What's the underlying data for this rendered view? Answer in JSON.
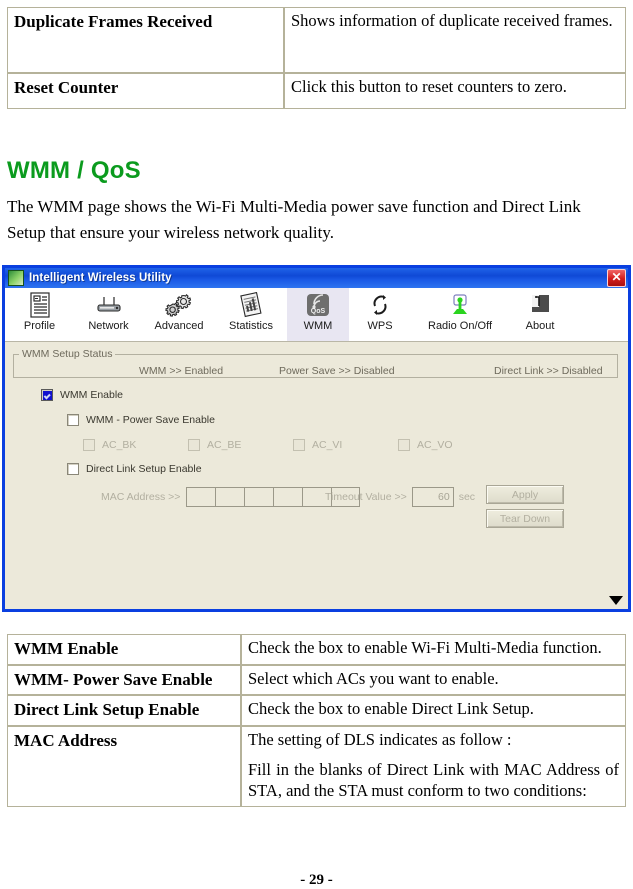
{
  "top_table": {
    "rows": [
      {
        "key": "Duplicate Frames Received",
        "value": "Shows information of duplicate received frames."
      },
      {
        "key": "Reset Counter",
        "value": "Click this button to reset counters to zero."
      }
    ]
  },
  "section": {
    "heading": "WMM / QoS",
    "intro": "The WMM page shows the Wi-Fi Multi-Media power save function and Direct Link Setup that ensure your wireless network quality."
  },
  "app": {
    "title": "Intelligent Wireless Utility",
    "close_label": "✕",
    "toolbar": [
      {
        "label": "Profile",
        "icon": "profile-icon",
        "selected": false
      },
      {
        "label": "Network",
        "icon": "network-icon",
        "selected": false
      },
      {
        "label": "Advanced",
        "icon": "advanced-icon",
        "selected": false
      },
      {
        "label": "Statistics",
        "icon": "statistics-icon",
        "selected": false
      },
      {
        "label": "WMM",
        "icon": "wmm-qos-icon",
        "selected": true
      },
      {
        "label": "WPS",
        "icon": "wps-icon",
        "selected": false
      },
      {
        "label": "Radio On/Off",
        "icon": "radio-onoff-icon",
        "selected": false
      },
      {
        "label": "About",
        "icon": "about-icon",
        "selected": false
      }
    ],
    "status_group": {
      "legend": "WMM Setup Status",
      "wmm": "WMM >> Enabled",
      "power_save": "Power Save >> Disabled",
      "direct_link": "Direct Link >> Disabled"
    },
    "controls": {
      "wmm_enable": "WMM Enable",
      "wmm_enable_checked": true,
      "power_save_enable": "WMM - Power Save Enable",
      "power_save_checked": false,
      "ac_items": [
        "AC_BK",
        "AC_BE",
        "AC_VI",
        "AC_VO"
      ],
      "direct_link_enable": "Direct Link Setup Enable",
      "direct_link_checked": false,
      "mac_address_label": "MAC Address >>",
      "mac_address_value": "",
      "mac_field_count": 6,
      "timeout_label": "Timeout Value >>",
      "timeout_value": "60",
      "timeout_unit": "sec",
      "apply_button": "Apply",
      "tear_down_button": "Tear Down"
    }
  },
  "bottom_table": {
    "rows": [
      {
        "key": "WMM Enable",
        "paragraphs": [
          "Check the box to enable Wi-Fi Multi-Media function."
        ]
      },
      {
        "key": "WMM- Power Save Enable",
        "paragraphs": [
          "Select which ACs you want to enable."
        ]
      },
      {
        "key": "Direct Link Setup Enable",
        "paragraphs": [
          "Check the box to enable Direct Link Setup."
        ]
      },
      {
        "key": "MAC Address",
        "paragraphs": [
          "The setting of DLS indicates as follow :",
          "Fill in the blanks of Direct Link with MAC Address of STA, and the STA must conform to two conditions:"
        ]
      }
    ]
  },
  "page_number": "- 29 -",
  "colors": {
    "heading_green": "#0b9b1e",
    "window_border_blue": "#0a3fe0",
    "panel_beige": "#ece9da",
    "tab_selected": "#e8e6f2",
    "checkbox_blue": "#1111cf"
  }
}
